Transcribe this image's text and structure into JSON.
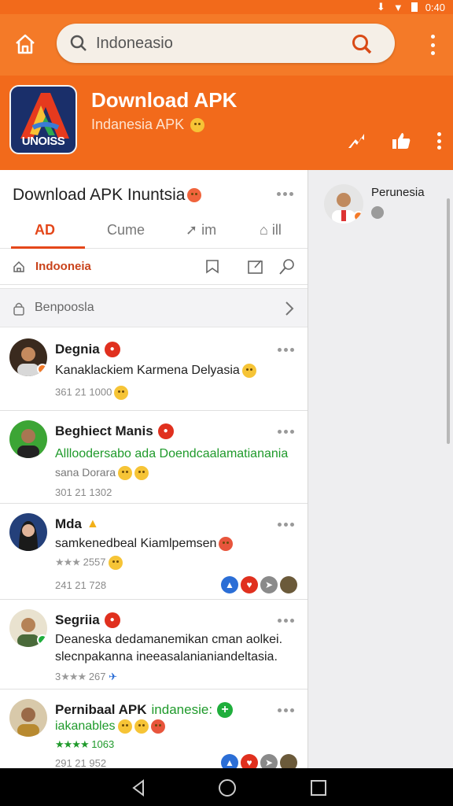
{
  "status_bar": {
    "time": "0:40"
  },
  "search": {
    "value": "Indoneasio"
  },
  "header": {
    "app_logo_text": "UNOISS",
    "title": "Download APK",
    "subtitle": "Indanesia APK"
  },
  "page": {
    "title": "Download APK Inuntsia",
    "tabs": [
      "AD",
      "Cume",
      "im",
      "ill"
    ],
    "active_tab": "AD",
    "filter_label": "Indooneia",
    "section_label": "Benpoosla"
  },
  "posts": [
    {
      "name": "Degnia",
      "line1": "Kanaklackiem Karmena Delyasia",
      "meta": "361 21 1000"
    },
    {
      "name": "Beghiect Manis",
      "line1": "Allloodersabo ada Doendcaalamatianania",
      "line2": "sana Dorara",
      "meta": "301 21 1302"
    },
    {
      "name": "Mda",
      "line1": "samkenedbeal Kiamlpemsen",
      "line2": "2557",
      "meta": "241 21 728"
    },
    {
      "name": "Segriia",
      "line1": "Deaneska dedamanemikan cman aolkei.",
      "line2": "slecnpakanna ineeasalanianiandeltasia.",
      "meta": "3",
      "meta_extra": "267"
    },
    {
      "name": "Pernibaal APK",
      "name_green": "indanesie:",
      "line1": "iakanables",
      "line2": "1063",
      "meta": "291 21 952"
    }
  ],
  "side": {
    "name": "Perunesia"
  },
  "colors": {
    "brand_orange": "#f26a1b",
    "accent_red": "#e4471a",
    "green": "#1f9a2b"
  }
}
